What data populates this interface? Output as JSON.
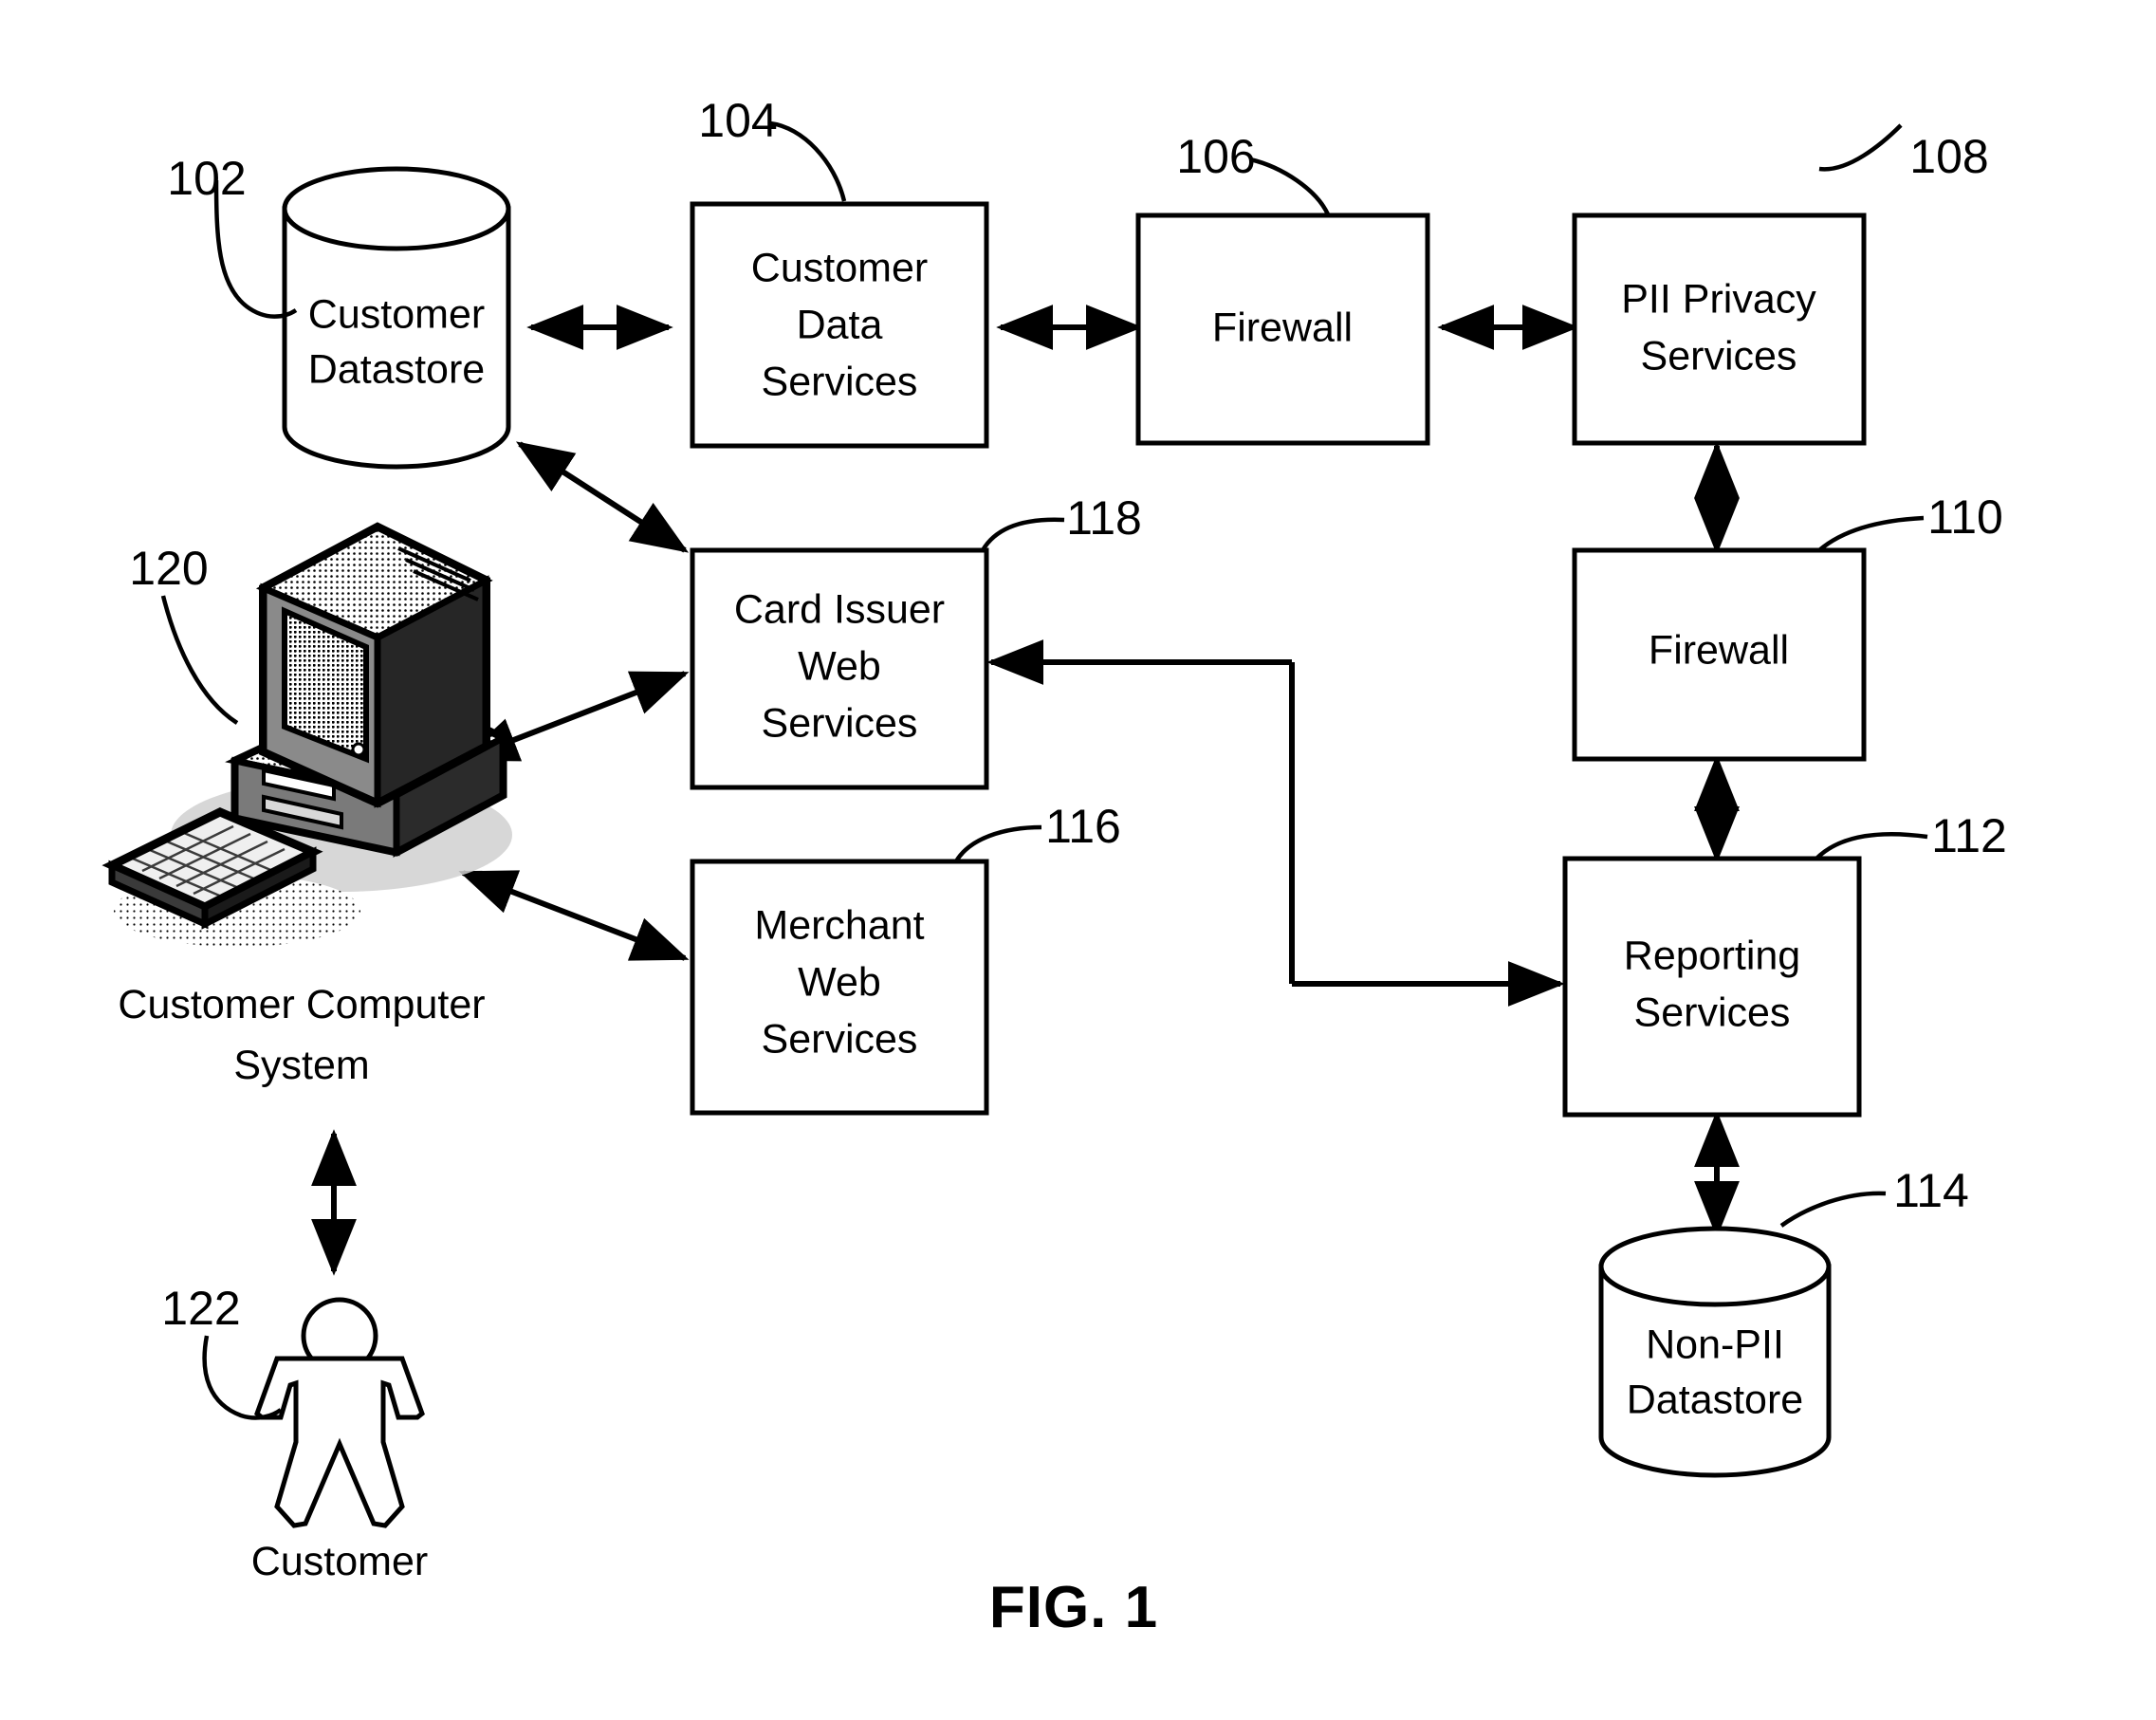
{
  "figure": {
    "caption": "FIG. 1",
    "title": "Customer data privacy system block diagram"
  },
  "nodes": [
    {
      "id": "customer_datastore",
      "ref": "102",
      "label_lines": [
        "Customer",
        "Datastore"
      ],
      "shape": "cylinder"
    },
    {
      "id": "customer_data_svcs",
      "ref": "104",
      "label_lines": [
        "Customer",
        "Data",
        "Services"
      ],
      "shape": "rect"
    },
    {
      "id": "firewall_1",
      "ref": "106",
      "label_lines": [
        "Firewall"
      ],
      "shape": "rect"
    },
    {
      "id": "pii_privacy_svcs",
      "ref": "108",
      "label_lines": [
        "PII Privacy",
        "Services"
      ],
      "shape": "rect"
    },
    {
      "id": "firewall_2",
      "ref": "110",
      "label_lines": [
        "Firewall"
      ],
      "shape": "rect"
    },
    {
      "id": "reporting_svcs",
      "ref": "112",
      "label_lines": [
        "Reporting",
        "Services"
      ],
      "shape": "rect"
    },
    {
      "id": "non_pii_datastore",
      "ref": "114",
      "label_lines": [
        "Non-PII",
        "Datastore"
      ],
      "shape": "cylinder"
    },
    {
      "id": "merchant_web_svcs",
      "ref": "116",
      "label_lines": [
        "Merchant",
        "Web",
        "Services"
      ],
      "shape": "rect"
    },
    {
      "id": "card_issuer_web_svcs",
      "ref": "118",
      "label_lines": [
        "Card Issuer",
        "Web",
        "Services"
      ],
      "shape": "rect"
    },
    {
      "id": "customer_computer",
      "ref": "120",
      "label_lines": [
        "Customer Computer",
        "System"
      ],
      "shape": "pictogram-computer"
    },
    {
      "id": "customer_person",
      "ref": "122",
      "label_lines": [
        "Customer"
      ],
      "shape": "pictogram-person"
    }
  ],
  "text": {
    "customer_datastore_l1": "Customer",
    "customer_datastore_l2": "Datastore",
    "customer_data_svcs_l1": "Customer",
    "customer_data_svcs_l2": "Data",
    "customer_data_svcs_l3": "Services",
    "firewall_1": "Firewall",
    "pii_privacy_svcs_l1": "PII Privacy",
    "pii_privacy_svcs_l2": "Services",
    "firewall_2": "Firewall",
    "reporting_svcs_l1": "Reporting",
    "reporting_svcs_l2": "Services",
    "non_pii_datastore_l1": "Non-PII",
    "non_pii_datastore_l2": "Datastore",
    "merchant_web_svcs_l1": "Merchant",
    "merchant_web_svcs_l2": "Web",
    "merchant_web_svcs_l3": "Services",
    "card_issuer_web_svcs_l1": "Card Issuer",
    "card_issuer_web_svcs_l2": "Web",
    "card_issuer_web_svcs_l3": "Services",
    "customer_computer_l1": "Customer Computer",
    "customer_computer_l2": "System",
    "customer_person_l1": "Customer",
    "fig_caption": "FIG. 1"
  },
  "ref_numerals": {
    "n102": "102",
    "n104": "104",
    "n106": "106",
    "n108": "108",
    "n110": "110",
    "n112": "112",
    "n114": "114",
    "n116": "116",
    "n118": "118",
    "n120": "120",
    "n122": "122"
  },
  "connections": [
    {
      "from": "customer_datastore",
      "to": "customer_data_svcs",
      "arrow": "double",
      "style": "straight"
    },
    {
      "from": "customer_data_svcs",
      "to": "firewall_1",
      "arrow": "double",
      "style": "straight"
    },
    {
      "from": "firewall_1",
      "to": "pii_privacy_svcs",
      "arrow": "double",
      "style": "straight"
    },
    {
      "from": "pii_privacy_svcs",
      "to": "firewall_2",
      "arrow": "double",
      "style": "straight"
    },
    {
      "from": "firewall_2",
      "to": "reporting_svcs",
      "arrow": "double",
      "style": "straight"
    },
    {
      "from": "reporting_svcs",
      "to": "non_pii_datastore",
      "arrow": "double",
      "style": "straight"
    },
    {
      "from": "customer_datastore",
      "to": "card_issuer_web_svcs",
      "arrow": "double",
      "style": "diagonal"
    },
    {
      "from": "customer_computer",
      "to": "card_issuer_web_svcs",
      "arrow": "double",
      "style": "diagonal"
    },
    {
      "from": "customer_computer",
      "to": "merchant_web_svcs",
      "arrow": "double",
      "style": "diagonal"
    },
    {
      "from": "card_issuer_web_svcs",
      "to": "reporting_svcs",
      "arrow": "single",
      "style": "elbow"
    },
    {
      "from": "customer_person",
      "to": "customer_computer",
      "arrow": "double",
      "style": "straight"
    }
  ],
  "colors": {
    "stroke": "#000000",
    "fill": "#ffffff",
    "background": "#ffffff"
  }
}
